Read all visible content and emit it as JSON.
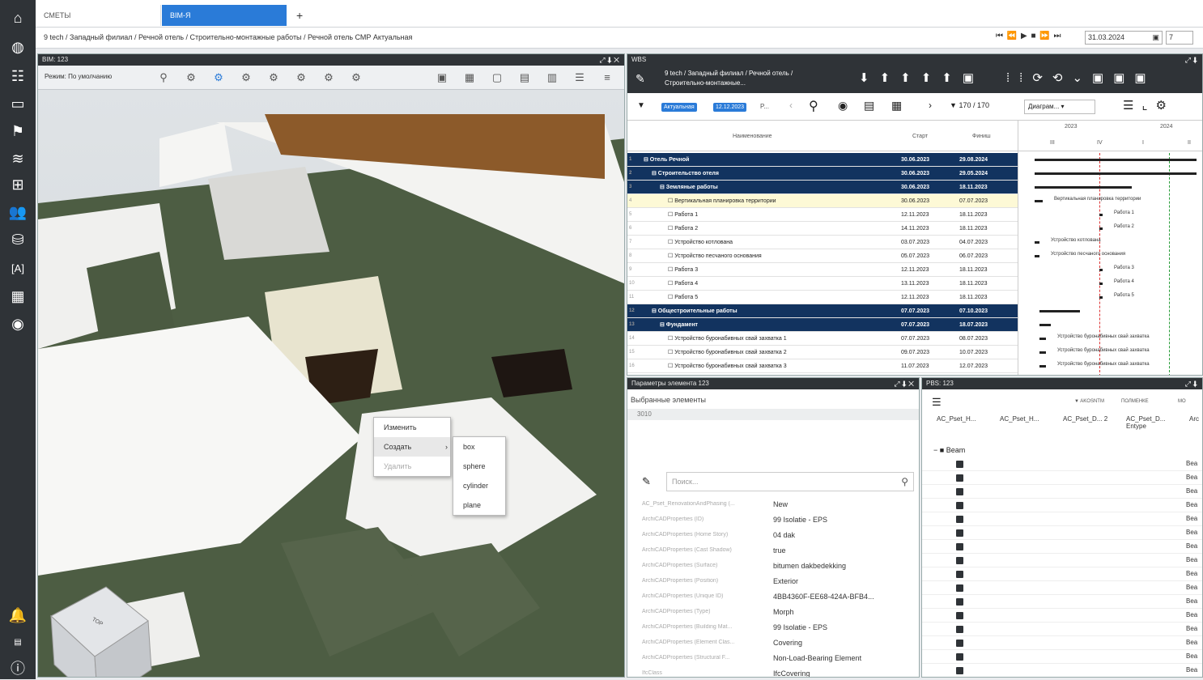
{
  "tabs": {
    "items": [
      "СМЕТЫ",
      "BIM-Я"
    ],
    "add": "+"
  },
  "breadcrumb": "9 tech / Западный филиал / Речной отель / Строительно-монтажные работы / Речной отель СМР Актуальная",
  "player": {
    "controls": "⏮ ⏪ ▶ ■ ⏩ ⏭",
    "date": "31.03.2024",
    "step": "7"
  },
  "bim": {
    "title": "BIM: 123",
    "mode_label": "Режим: По умолчанию",
    "context_menu": {
      "edit": "Изменить",
      "create": "Создать",
      "delete": "Удалить",
      "arrow": "›"
    },
    "submenu": [
      "box",
      "sphere",
      "cylinder",
      "plane"
    ],
    "navcube_label": "TOP"
  },
  "wbs": {
    "title": "WBS",
    "path": "9 tech / Западный филиал / Речной отель / Строительно-монтажные...",
    "filter_active": "Актуальная",
    "filter_date": "12.12.2023",
    "filter_more": "P...",
    "count": "170 / 170",
    "view": "Диаграм...",
    "columns": {
      "name": "Наименование",
      "start": "Старт",
      "finish": "Финиш"
    },
    "timeline": {
      "year": "2023",
      "year2": "2024",
      "q": [
        "III",
        "IV",
        "I",
        "II"
      ]
    },
    "rows": [
      {
        "n": "1",
        "name": "⊟ Отель Речной",
        "start": "30.06.2023",
        "finish": "29.08.2024",
        "style": "sel",
        "indent": 0
      },
      {
        "n": "2",
        "name": "⊟ Строительство отеля",
        "start": "30.06.2023",
        "finish": "29.05.2024",
        "style": "sel",
        "indent": 1
      },
      {
        "n": "3",
        "name": "⊟ Земляные работы",
        "start": "30.06.2023",
        "finish": "18.11.2023",
        "style": "sel",
        "indent": 2
      },
      {
        "n": "4",
        "name": "☐ Вертикальная планировка территории",
        "start": "30.06.2023",
        "finish": "07.07.2023",
        "style": "yel",
        "indent": 3
      },
      {
        "n": "5",
        "name": "☐ Работа 1",
        "start": "12.11.2023",
        "finish": "18.11.2023",
        "style": "",
        "indent": 3
      },
      {
        "n": "6",
        "name": "☐ Работа 2",
        "start": "14.11.2023",
        "finish": "18.11.2023",
        "style": "",
        "indent": 3
      },
      {
        "n": "7",
        "name": "☐ Устройство котлована",
        "start": "03.07.2023",
        "finish": "04.07.2023",
        "style": "",
        "indent": 3
      },
      {
        "n": "8",
        "name": "☐ Устройство песчаного основания",
        "start": "05.07.2023",
        "finish": "06.07.2023",
        "style": "",
        "indent": 3
      },
      {
        "n": "9",
        "name": "☐ Работа 3",
        "start": "12.11.2023",
        "finish": "18.11.2023",
        "style": "",
        "indent": 3
      },
      {
        "n": "10",
        "name": "☐ Работа 4",
        "start": "13.11.2023",
        "finish": "18.11.2023",
        "style": "",
        "indent": 3
      },
      {
        "n": "11",
        "name": "☐ Работа 5",
        "start": "12.11.2023",
        "finish": "18.11.2023",
        "style": "",
        "indent": 3
      },
      {
        "n": "12",
        "name": "⊟ Общестроительные работы",
        "start": "07.07.2023",
        "finish": "07.10.2023",
        "style": "sel",
        "indent": 1
      },
      {
        "n": "13",
        "name": "⊟ Фундамент",
        "start": "07.07.2023",
        "finish": "18.07.2023",
        "style": "sel",
        "indent": 2
      },
      {
        "n": "14",
        "name": "☐ Устройство буронабивных свай захватка 1",
        "start": "07.07.2023",
        "finish": "08.07.2023",
        "style": "",
        "indent": 3
      },
      {
        "n": "15",
        "name": "☐ Устройство буронабивных свай захватка 2",
        "start": "09.07.2023",
        "finish": "10.07.2023",
        "style": "",
        "indent": 3
      },
      {
        "n": "16",
        "name": "☐ Устройство буронабивных свай захватка 3",
        "start": "11.07.2023",
        "finish": "12.07.2023",
        "style": "",
        "indent": 3
      }
    ],
    "gantt_labels": [
      "Вертикальная планировка территории",
      "Работа 1",
      "Работа 2",
      "Устройство котлована",
      "Устройство песчаного основания",
      "Работа 3",
      "Работа 4",
      "Работа 5",
      "Устройство буронабивных свай захватка",
      "Устройство буронабивных свай захватка",
      "Устройство буронабивных свай захватка"
    ]
  },
  "params": {
    "title": "Параметры элемента 123",
    "selected_label": "Выбранные элементы",
    "selected_value": "3010",
    "search_placeholder": "Поиск...",
    "props": [
      {
        "k": "AC_Pset_RenovationAndPhasing (...",
        "v": "New"
      },
      {
        "k": "ArchiCADProperties (ID)",
        "v": "99 Isolatie - EPS"
      },
      {
        "k": "ArchiCADProperties (Home Story)",
        "v": "04 dak"
      },
      {
        "k": "ArchiCADProperties (Cast Shadow)",
        "v": "true"
      },
      {
        "k": "ArchiCADProperties (Surface)",
        "v": "bitumen dakbedekking"
      },
      {
        "k": "ArchiCADProperties (Position)",
        "v": "Exterior"
      },
      {
        "k": "ArchiCADProperties (Unique ID)",
        "v": "4BB4360F-EE68-424A-BFB4..."
      },
      {
        "k": "ArchiCADProperties (Type)",
        "v": "Morph"
      },
      {
        "k": "ArchiCADProperties (Building Mat...",
        "v": "99 Isolatie - EPS"
      },
      {
        "k": "ArchiCADProperties (Element Clas...",
        "v": "Covering"
      },
      {
        "k": "ArchiCADProperties (Structural F...",
        "v": "Non-Load-Bearing Element"
      },
      {
        "k": "IfcClass",
        "v": "IfcCovering"
      }
    ]
  },
  "pbs": {
    "title": "PBS: 123",
    "toolbar": [
      "▼ AKOSNTM",
      "ПОЛМЕНКЕ",
      "MO"
    ],
    "columns": [
      "AC_Pset_H...",
      "AC_Pset_H...",
      "AC_Pset_D... 2",
      "AC_Pset_D... Entype",
      "Arc"
    ],
    "group": "Beam",
    "row_count": 16,
    "cell_value": "Bea"
  }
}
